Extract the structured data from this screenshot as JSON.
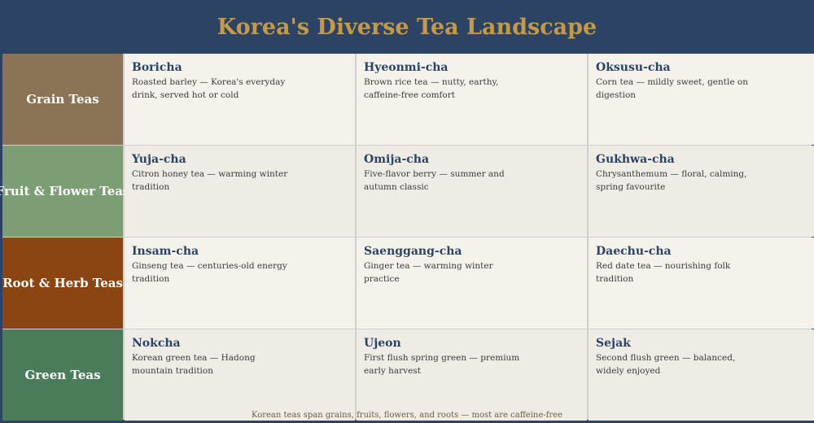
{
  "title": "Korea's Diverse Tea Landscape",
  "footer": "Korean teas span grains, fruits, flowers, and roots — most are caffeine-free",
  "colors": {
    "header_bg": "#2c4364",
    "title": "#c49a4a",
    "grain": "#8b7355",
    "fruit_flower": "#7d9e74",
    "root_herb": "#8b4513",
    "green": "#4a7c59"
  },
  "rows": [
    {
      "category": "Grain Teas",
      "teas": [
        {
          "name": "Boricha",
          "desc": "Roasted barley — Korea's everyday drink, served hot or cold"
        },
        {
          "name": "Hyeonmi-cha",
          "desc": "Brown rice tea — nutty, earthy, caffeine-free comfort"
        },
        {
          "name": "Oksusu-cha",
          "desc": "Corn tea — mildly sweet, gentle on digestion"
        }
      ]
    },
    {
      "category": "Fruit & Flower Teas",
      "teas": [
        {
          "name": "Yuja-cha",
          "desc": "Citron honey tea — warming winter tradition"
        },
        {
          "name": "Omija-cha",
          "desc": "Five-flavor berry — summer and autumn classic"
        },
        {
          "name": "Gukhwa-cha",
          "desc": "Chrysanthemum — floral, calming, spring favourite"
        }
      ]
    },
    {
      "category": "Root & Herb Teas",
      "teas": [
        {
          "name": "Insam-cha",
          "desc": "Ginseng tea — centuries-old energy tradition"
        },
        {
          "name": "Saenggang-cha",
          "desc": "Ginger tea — warming winter practice"
        },
        {
          "name": "Daechu-cha",
          "desc": "Red date tea — nourishing folk tradition"
        }
      ]
    },
    {
      "category": "Green Teas",
      "teas": [
        {
          "name": "Nokcha",
          "desc": "Korean green tea — Hadong mountain tradition"
        },
        {
          "name": "Ujeon",
          "desc": "First flush spring green — premium early harvest"
        },
        {
          "name": "Sejak",
          "desc": "Second flush green — balanced, widely enjoyed"
        }
      ]
    }
  ]
}
